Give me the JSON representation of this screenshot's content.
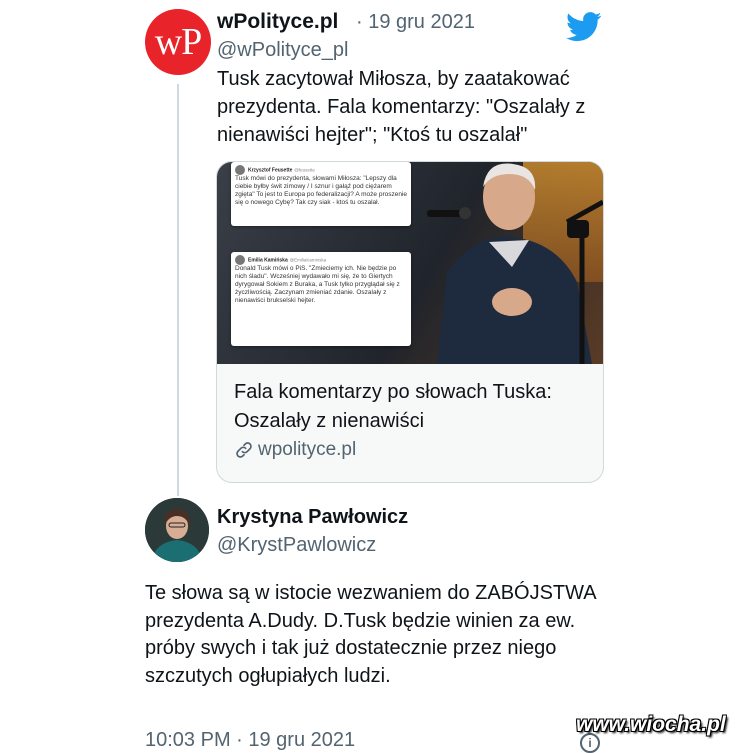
{
  "tweet1": {
    "avatar_text": "wP",
    "name": "wPolityce.pl",
    "date": "· 19 gru 2021",
    "handle": "@wPolityce_pl",
    "text": "Tusk zacytował Miłosza, by zaatakować prezydenta. Fala komentarzy: \"Oszalały z nienawiści hejter\"; \"Ktoś tu oszalał\"",
    "card": {
      "title": "Fala komentarzy po słowach Tuska: Oszalały z nienawiści",
      "domain": "wpolityce.pl",
      "mini_tweet_1": {
        "name": "Krzysztof Feusette",
        "handle": "@feusette",
        "text": "Tusk mówi do prezydenta, słowami Miłosza: \"Lepszy dla ciebie byłby świt zimowy / I sznur i gałąź pod ciężarem zgięta\" To jest to Europa po federalizacji? A może proszenie się o nowego Cybę? Tak czy siak - ktoś tu oszalał."
      },
      "mini_tweet_2": {
        "name": "Emilia Kamińska",
        "handle": "@EmiliaKaminska",
        "text": "Donald Tusk mówi o PiS. \"Zmieciemy ich. Nie będzie po nich śladu\". Wcześniej wydawało mi się, że to Giertych dyrygował Sokiem z Buraka, a Tusk tylko przyglądał się z życzliwością. Zaczynam zmieniać zdanie. Oszalały z nienawiści brukselski hejter."
      }
    }
  },
  "tweet2": {
    "name": "Krystyna Pawłowicz",
    "handle": "@KrystPawlowicz",
    "text": "Te słowa są w istocie wezwaniem do ZABÓJSTWA prezydenta A.Dudy. D.Tusk będzie winien za ew. próby  swych i tak już dostatecznie przez niego szczutych ogłupiałych ludzi.",
    "timestamp": "10:03 PM · 19 gru 2021"
  },
  "watermark": "www.wiocha.pl",
  "icons": {
    "platform": "twitter-bird-icon",
    "link": "link-icon",
    "info": "info-icon"
  },
  "colors": {
    "twitter_blue": "#1d9bf0",
    "wp_red": "#e8232a",
    "secondary_text": "#536471"
  }
}
